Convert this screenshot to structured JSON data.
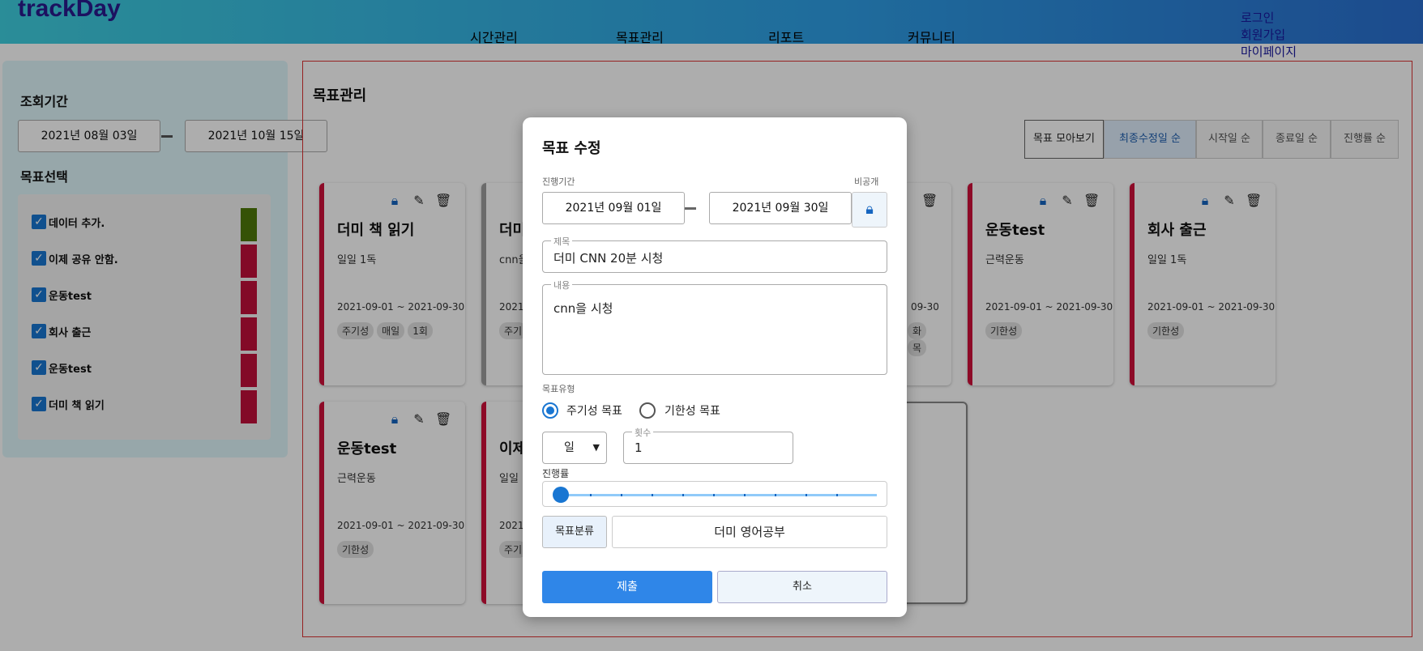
{
  "brand": {
    "logo": "trackDay"
  },
  "nav": [
    "시간관리",
    "목표관리",
    "리포트",
    "커뮤니티"
  ],
  "auth": [
    "로그인",
    "회원가입",
    "마이페이지"
  ],
  "sidebar": {
    "period_label": "조회기간",
    "start_date": "2021년 08월 03일",
    "end_date": "2021년 10월 15일",
    "select_label": "목표선택",
    "items": [
      {
        "label": "데이터 추가.",
        "color": "#4f7a0a"
      },
      {
        "label": "이제 공유 안함.",
        "color": "#c2103a"
      },
      {
        "label": "운동test",
        "color": "#c2103a"
      },
      {
        "label": "회사 출근",
        "color": "#c2103a"
      },
      {
        "label": "운동test",
        "color": "#c2103a"
      },
      {
        "label": "더미 책 읽기",
        "color": "#c2103a"
      }
    ]
  },
  "main": {
    "title": "목표관리",
    "sort_buttons": [
      "목표 모아보기",
      "최종수정일 순",
      "시작일 순",
      "종료일 순",
      "진행률 순"
    ],
    "cards": [
      {
        "title": "더미 책 읽기",
        "desc": "일일 1독",
        "range": "2021-09-01 ~ 2021-09-30",
        "tags": [
          "주기성",
          "매일",
          "1회"
        ]
      },
      {
        "title": "더미",
        "desc": "cnn을",
        "range": "2021",
        "tags": [
          "주기"
        ]
      },
      {
        "title": "",
        "desc": "",
        "range": "09-30",
        "tags": [
          "화",
          "목"
        ]
      },
      {
        "title": "운동test",
        "desc": "근력운동",
        "range": "2021-09-01 ~ 2021-09-30",
        "tags": [
          "기한성"
        ]
      },
      {
        "title": "회사 출근",
        "desc": "일일 1독",
        "range": "2021-09-01 ~ 2021-09-30",
        "tags": [
          "기한성"
        ]
      },
      {
        "title": "운동test",
        "desc": "근력운동",
        "range": "2021-09-01 ~ 2021-09-30",
        "tags": [
          "기한성"
        ]
      },
      {
        "title": "이제",
        "desc": "일일",
        "range": "2021",
        "tags": [
          "주기"
        ]
      }
    ]
  },
  "modal": {
    "title": "목표 수정",
    "period_label": "진행기간",
    "private_label": "비공개",
    "start_date": "2021년 09월 01일",
    "end_date": "2021년 09월 30일",
    "title_legend": "제목",
    "title_value": "더미 CNN  20분 시청",
    "content_legend": "내용",
    "content_value": "cnn을 시청",
    "type_label": "목표유형",
    "type_periodic": "주기성 목표",
    "type_deadline": "기한성 목표",
    "period_unit": "일",
    "count_legend": "횟수",
    "count_value": "1",
    "progress_label": "진행률",
    "progress_value": 0,
    "category_button": "목표분류",
    "category_value": "더미 영어공부",
    "submit": "제출",
    "cancel": "취소"
  }
}
